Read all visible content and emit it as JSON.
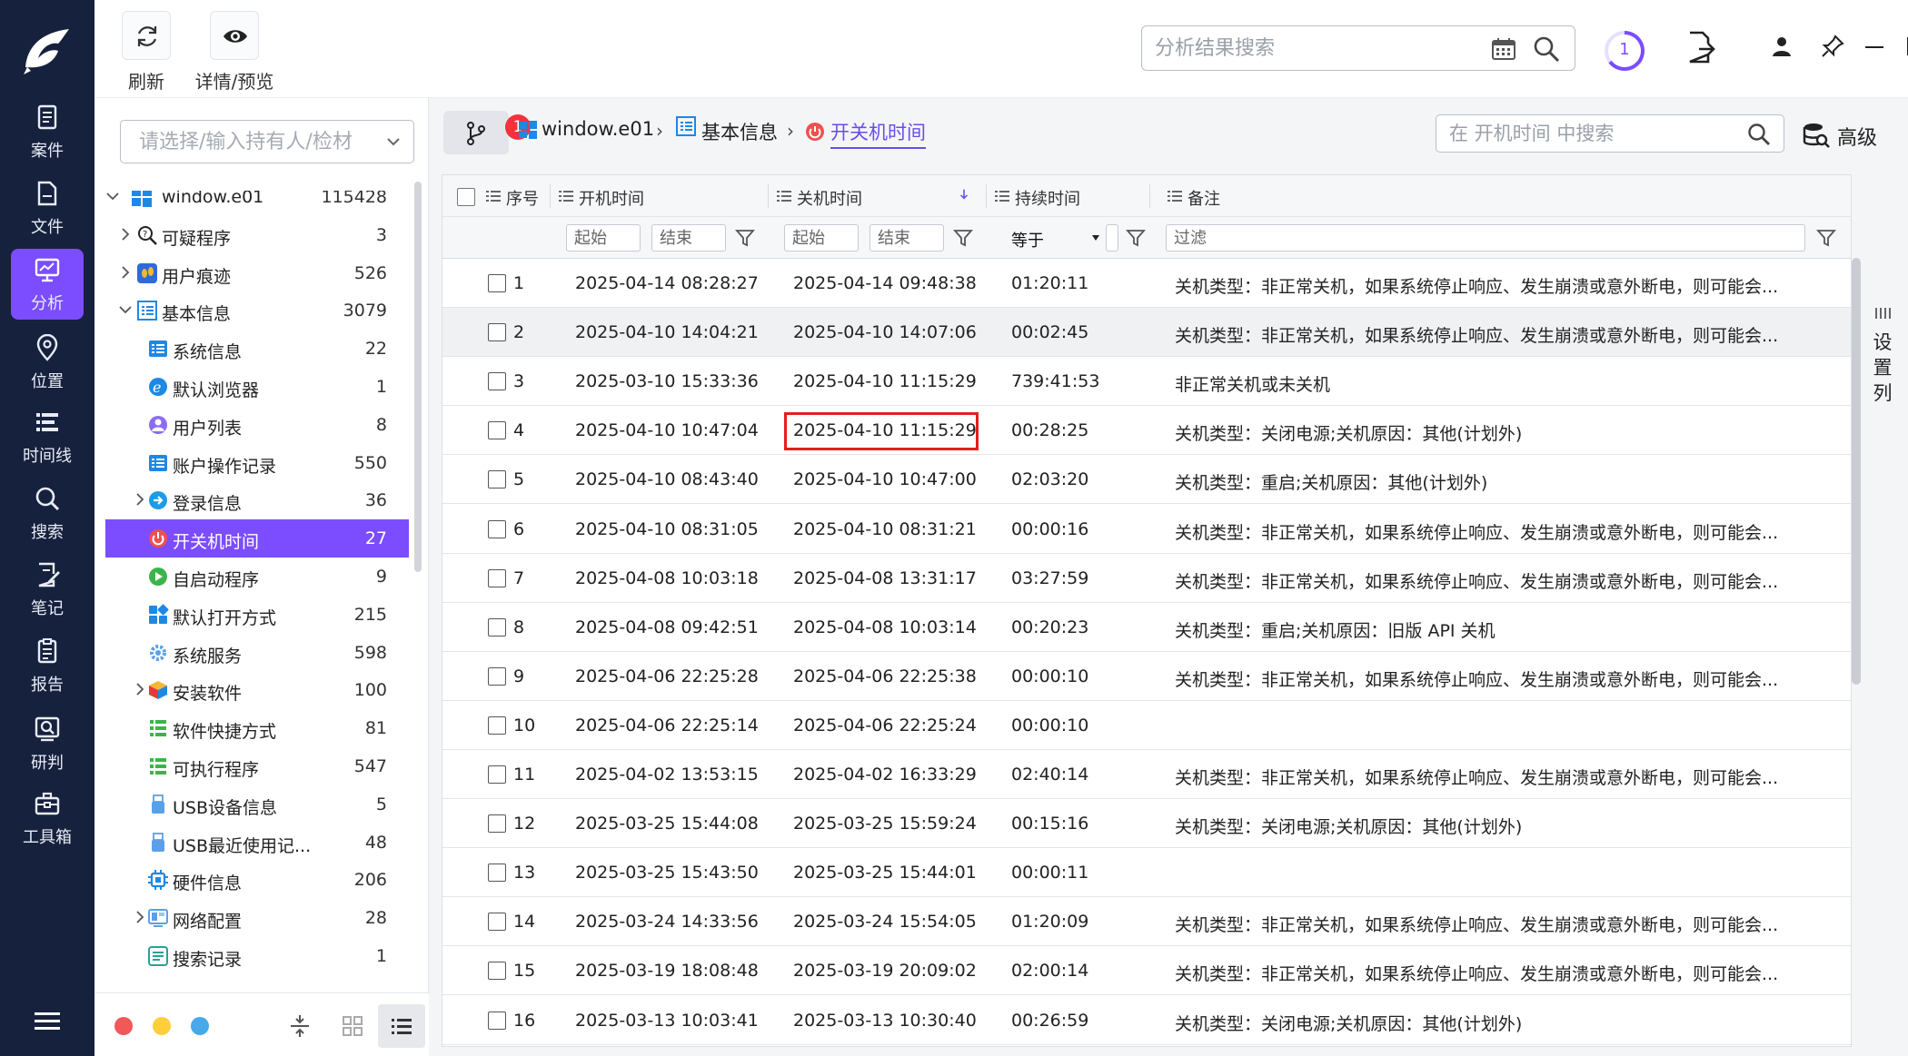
{
  "toolbar": {
    "refresh_label": "刷新",
    "details_label": "详情/预览"
  },
  "top_search": {
    "placeholder": "分析结果搜索"
  },
  "task_badge": "1",
  "nav": [
    {
      "key": "case",
      "label": "案件",
      "icon": "case-icon"
    },
    {
      "key": "file",
      "label": "文件",
      "icon": "file-icon"
    },
    {
      "key": "analysis",
      "label": "分析",
      "icon": "analysis-icon",
      "active": true
    },
    {
      "key": "location",
      "label": "位置",
      "icon": "location-icon"
    },
    {
      "key": "timeline",
      "label": "时间线",
      "icon": "timeline-icon"
    },
    {
      "key": "search",
      "label": "搜索",
      "icon": "search-icon"
    },
    {
      "key": "notes",
      "label": "笔记",
      "icon": "notes-icon"
    },
    {
      "key": "report",
      "label": "报告",
      "icon": "report-icon"
    },
    {
      "key": "judge",
      "label": "研判",
      "icon": "judge-icon"
    },
    {
      "key": "toolbox",
      "label": "工具箱",
      "icon": "toolbox-icon"
    }
  ],
  "tree_search": {
    "placeholder": "请选择/输入持有人/检材"
  },
  "tree": [
    {
      "label": "window.e01",
      "count": "115428",
      "level": 0,
      "arrow": "down",
      "icon": "windows-icon"
    },
    {
      "label": "可疑程序",
      "count": "3",
      "level": 1,
      "arrow": "right",
      "icon": "suspicious-icon"
    },
    {
      "label": "用户痕迹",
      "count": "526",
      "level": 1,
      "arrow": "right",
      "icon": "footprint-icon"
    },
    {
      "label": "基本信息",
      "count": "3079",
      "level": 1,
      "arrow": "down",
      "icon": "info-list-icon"
    },
    {
      "label": "系统信息",
      "count": "22",
      "level": 2,
      "icon": "system-info-icon"
    },
    {
      "label": "默认浏览器",
      "count": "1",
      "level": 2,
      "icon": "browser-icon"
    },
    {
      "label": "用户列表",
      "count": "8",
      "level": 2,
      "icon": "user-icon"
    },
    {
      "label": "账户操作记录",
      "count": "550",
      "level": 2,
      "icon": "account-log-icon"
    },
    {
      "label": "登录信息",
      "count": "36",
      "level": 2,
      "arrow": "right",
      "icon": "login-icon"
    },
    {
      "label": "开关机时间",
      "count": "27",
      "level": 2,
      "icon": "power-icon",
      "selected": true
    },
    {
      "label": "自启动程序",
      "count": "9",
      "level": 2,
      "icon": "autostart-icon"
    },
    {
      "label": "默认打开方式",
      "count": "215",
      "level": 2,
      "icon": "default-open-icon"
    },
    {
      "label": "系统服务",
      "count": "598",
      "level": 2,
      "icon": "service-icon"
    },
    {
      "label": "安装软件",
      "count": "100",
      "level": 2,
      "arrow": "right",
      "icon": "package-icon"
    },
    {
      "label": "软件快捷方式",
      "count": "81",
      "level": 2,
      "icon": "shortcut-icon"
    },
    {
      "label": "可执行程序",
      "count": "547",
      "level": 2,
      "icon": "executable-icon"
    },
    {
      "label": "USB设备信息",
      "count": "5",
      "level": 2,
      "icon": "usb-icon"
    },
    {
      "label": "USB最近使用记...",
      "count": "48",
      "level": 2,
      "icon": "usb-recent-icon"
    },
    {
      "label": "硬件信息",
      "count": "206",
      "level": 2,
      "icon": "chip-icon"
    },
    {
      "label": "网络配置",
      "count": "28",
      "level": 2,
      "arrow": "right",
      "icon": "network-icon"
    },
    {
      "label": "搜索记录",
      "count": "1",
      "level": 2,
      "icon": "search-record-icon"
    }
  ],
  "breadcrumb": {
    "badge": "1",
    "items": [
      "window.e01",
      "基本信息",
      "开关机时间"
    ]
  },
  "main_search": {
    "placeholder": "在 开机时间 中搜索"
  },
  "advanced_label": "高级",
  "settings_label": "设置列",
  "columns": {
    "index": "序号",
    "boot_time": "开机时间",
    "shutdown_time": "关机时间",
    "duration": "持续时间",
    "notes": "备注"
  },
  "filters": {
    "start_placeholder": "起始",
    "end_placeholder": "结束",
    "equals_label": "等于",
    "filter_placeholder": "过滤"
  },
  "rows": [
    {
      "idx": "1",
      "boot": "2025-04-14 08:28:27",
      "shut": "2025-04-14 09:48:38",
      "dur": "01:20:11",
      "note": "关机类型：非正常关机，如果系统停止响应、发生崩溃或意外断电，则可能会..."
    },
    {
      "idx": "2",
      "boot": "2025-04-10 14:04:21",
      "shut": "2025-04-10 14:07:06",
      "dur": "00:02:45",
      "note": "关机类型：非正常关机，如果系统停止响应、发生崩溃或意外断电，则可能会..."
    },
    {
      "idx": "3",
      "boot": "2025-03-10 15:33:36",
      "shut": "2025-04-10 11:15:29",
      "dur": "739:41:53",
      "note": "非正常关机或未关机"
    },
    {
      "idx": "4",
      "boot": "2025-04-10 10:47:04",
      "shut": "2025-04-10 11:15:29",
      "dur": "00:28:25",
      "note": "关机类型：关闭电源;关机原因：其他(计划外)"
    },
    {
      "idx": "5",
      "boot": "2025-04-10 08:43:40",
      "shut": "2025-04-10 10:47:00",
      "dur": "02:03:20",
      "note": "关机类型：重启;关机原因：其他(计划外)"
    },
    {
      "idx": "6",
      "boot": "2025-04-10 08:31:05",
      "shut": "2025-04-10 08:31:21",
      "dur": "00:00:16",
      "note": "关机类型：非正常关机，如果系统停止响应、发生崩溃或意外断电，则可能会..."
    },
    {
      "idx": "7",
      "boot": "2025-04-08 10:03:18",
      "shut": "2025-04-08 13:31:17",
      "dur": "03:27:59",
      "note": "关机类型：非正常关机，如果系统停止响应、发生崩溃或意外断电，则可能会..."
    },
    {
      "idx": "8",
      "boot": "2025-04-08 09:42:51",
      "shut": "2025-04-08 10:03:14",
      "dur": "00:20:23",
      "note": "关机类型：重启;关机原因：旧版 API 关机"
    },
    {
      "idx": "9",
      "boot": "2025-04-06 22:25:28",
      "shut": "2025-04-06 22:25:38",
      "dur": "00:00:10",
      "note": "关机类型：非正常关机，如果系统停止响应、发生崩溃或意外断电，则可能会..."
    },
    {
      "idx": "10",
      "boot": "2025-04-06 22:25:14",
      "shut": "2025-04-06 22:25:24",
      "dur": "00:00:10",
      "note": ""
    },
    {
      "idx": "11",
      "boot": "2025-04-02 13:53:15",
      "shut": "2025-04-02 16:33:29",
      "dur": "02:40:14",
      "note": "关机类型：非正常关机，如果系统停止响应、发生崩溃或意外断电，则可能会..."
    },
    {
      "idx": "12",
      "boot": "2025-03-25 15:44:08",
      "shut": "2025-03-25 15:59:24",
      "dur": "00:15:16",
      "note": "关机类型：关闭电源;关机原因：其他(计划外)"
    },
    {
      "idx": "13",
      "boot": "2025-03-25 15:43:50",
      "shut": "2025-03-25 15:44:01",
      "dur": "00:00:11",
      "note": ""
    },
    {
      "idx": "14",
      "boot": "2025-03-24 14:33:56",
      "shut": "2025-03-24 15:54:05",
      "dur": "01:20:09",
      "note": "关机类型：非正常关机，如果系统停止响应、发生崩溃或意外断电，则可能会..."
    },
    {
      "idx": "15",
      "boot": "2025-03-19 18:08:48",
      "shut": "2025-03-19 20:09:02",
      "dur": "02:00:14",
      "note": "关机类型：非正常关机，如果系统停止响应、发生崩溃或意外断电，则可能会..."
    },
    {
      "idx": "16",
      "boot": "2025-03-13 10:03:41",
      "shut": "2025-03-13 10:30:40",
      "dur": "00:26:59",
      "note": "关机类型：关闭电源;关机原因：其他(计划外)"
    }
  ],
  "colors": {
    "accent": "#7b4dff",
    "nav_bg": "#16213e",
    "highlight_border": "#e41e1e",
    "badge_red": "#f5323c"
  }
}
